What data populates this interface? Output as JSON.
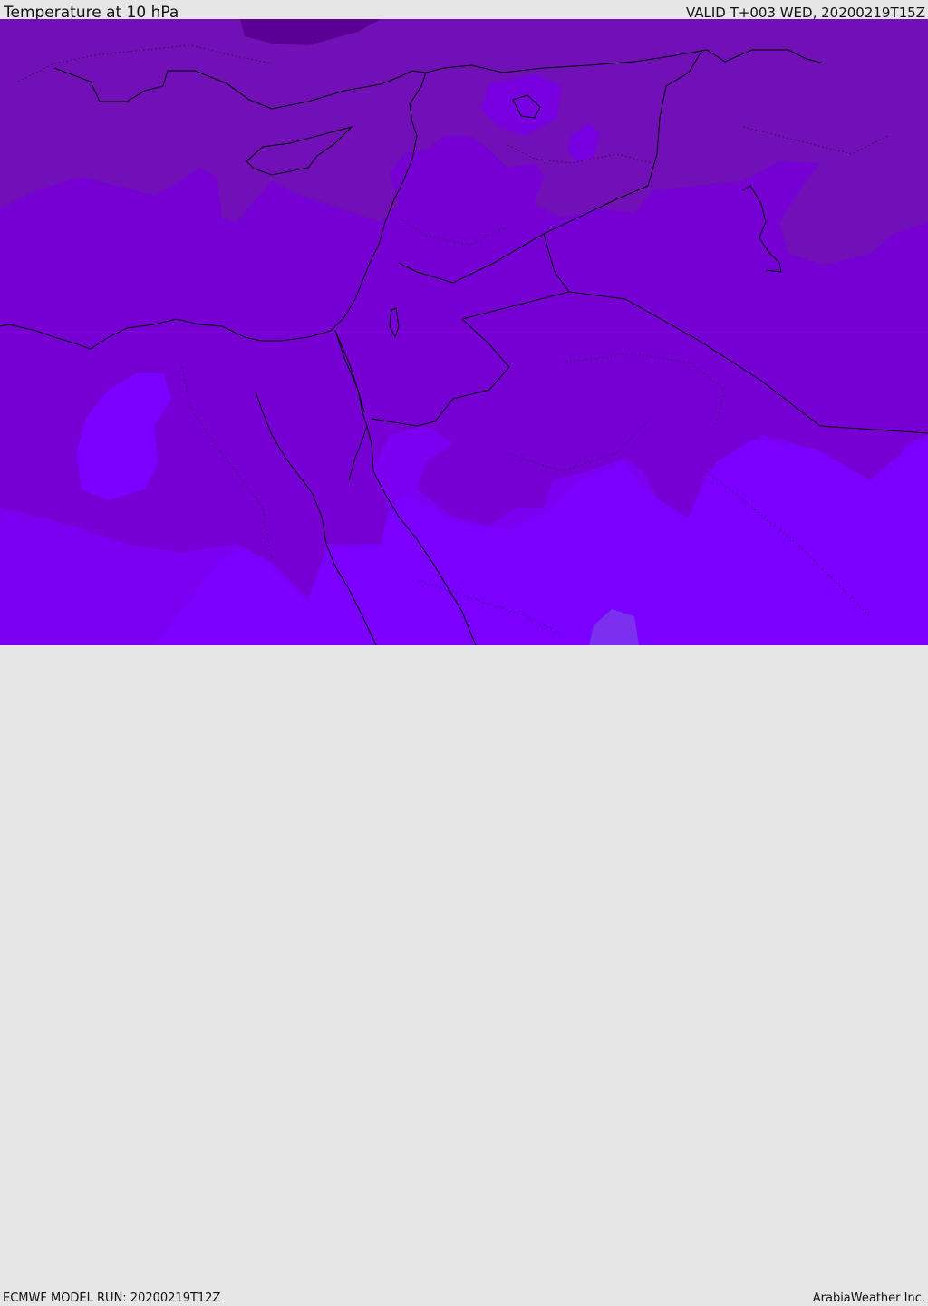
{
  "header": {
    "title": "Temperature at 10 hPa",
    "valid_time": "VALID T+003 WED, 20200219T15Z"
  },
  "footer": {
    "model_run": "ECMWF MODEL RUN: 20200219T12Z",
    "credit": "ArabiaWeather Inc."
  },
  "map": {
    "field_colors": {
      "warmest": "#7a00ff",
      "warm": "#7b00e8",
      "mid": "#7600d4",
      "cool": "#7010b6",
      "coldest": "#5a0094",
      "patch": "#7b30f0"
    },
    "line_color": "#000000"
  }
}
